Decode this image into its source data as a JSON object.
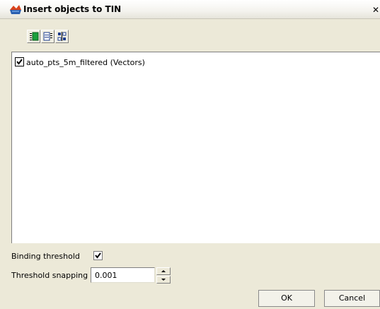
{
  "window": {
    "title": "Insert objects to TIN",
    "close_glyph": "✕"
  },
  "toolbar": {
    "buttons": [
      {
        "icon": "select-all-icon"
      },
      {
        "icon": "deselect-all-icon"
      },
      {
        "icon": "invert-selection-icon"
      }
    ]
  },
  "list": {
    "items": [
      {
        "label": "auto_pts_5m_filtered (Vectors)",
        "checked": true
      }
    ]
  },
  "form": {
    "binding_threshold_label": "Binding threshold",
    "binding_threshold_checked": true,
    "threshold_snapping_label": "Threshold snapping",
    "threshold_snapping_value": "0.001"
  },
  "buttons": {
    "ok": "OK",
    "cancel": "Cancel"
  },
  "colors": {
    "dialog_bg": "#ece9d8",
    "accent_blue": "#1c3c8c",
    "icon_green": "#1aa03c"
  }
}
